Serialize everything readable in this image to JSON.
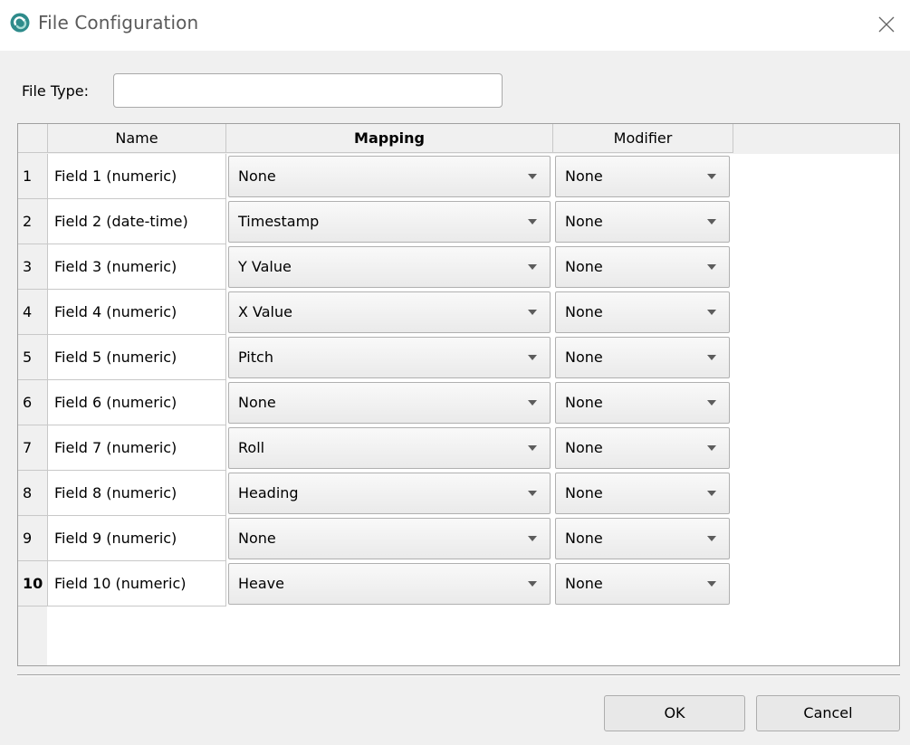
{
  "window": {
    "title": "File Configuration",
    "icon": "app-logo-icon",
    "close_icon": "close-icon"
  },
  "file_type": {
    "label": "File Type:",
    "value": ""
  },
  "table": {
    "headers": {
      "name": "Name",
      "mapping": "Mapping",
      "modifier": "Modifier"
    },
    "rows": [
      {
        "num": "1",
        "name": "Field 1 (numeric)",
        "mapping": "None",
        "modifier": "None"
      },
      {
        "num": "2",
        "name": "Field 2 (date-time)",
        "mapping": "Timestamp",
        "modifier": "None"
      },
      {
        "num": "3",
        "name": "Field 3 (numeric)",
        "mapping": "Y Value",
        "modifier": "None"
      },
      {
        "num": "4",
        "name": "Field 4 (numeric)",
        "mapping": "X Value",
        "modifier": "None"
      },
      {
        "num": "5",
        "name": "Field 5 (numeric)",
        "mapping": "Pitch",
        "modifier": "None"
      },
      {
        "num": "6",
        "name": "Field 6 (numeric)",
        "mapping": "None",
        "modifier": "None"
      },
      {
        "num": "7",
        "name": "Field 7 (numeric)",
        "mapping": "Roll",
        "modifier": "None"
      },
      {
        "num": "8",
        "name": "Field 8 (numeric)",
        "mapping": "Heading",
        "modifier": "None"
      },
      {
        "num": "9",
        "name": "Field 9 (numeric)",
        "mapping": "None",
        "modifier": "None"
      },
      {
        "num": "10",
        "name": "Field 10 (numeric)",
        "mapping": "Heave",
        "modifier": "None"
      }
    ]
  },
  "buttons": {
    "ok": "OK",
    "cancel": "Cancel"
  },
  "colors": {
    "accent_teal": "#2e8b8b",
    "background": "#f0f0f0"
  }
}
